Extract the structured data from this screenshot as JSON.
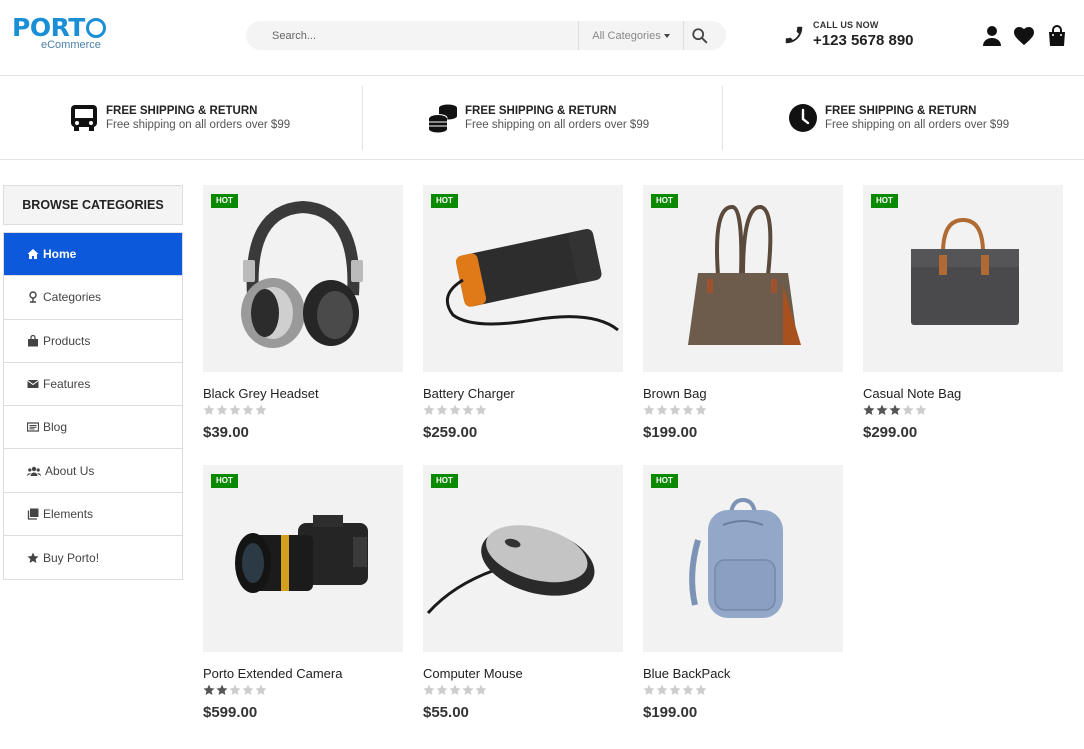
{
  "brand": {
    "name_prefix": "PORT",
    "sub": "eCommerce"
  },
  "search": {
    "placeholder": "Search...",
    "category": "All Categories"
  },
  "contact": {
    "label": "CALL US NOW",
    "number": "+123 5678 890"
  },
  "info_bar": [
    {
      "icon": "bus-icon",
      "title": "FREE SHIPPING & RETURN",
      "text": "Free shipping on all orders over $99"
    },
    {
      "icon": "coins-icon",
      "title": "FREE SHIPPING & RETURN",
      "text": "Free shipping on all orders over $99"
    },
    {
      "icon": "clock-icon",
      "title": "FREE SHIPPING & RETURN",
      "text": "Free shipping on all orders over $99"
    }
  ],
  "sidebar": {
    "title": "BROWSE CATEGORIES",
    "items": [
      {
        "label": "Home",
        "icon": "home-icon",
        "active": true
      },
      {
        "label": "Categories",
        "icon": "categories-icon"
      },
      {
        "label": "Products",
        "icon": "bag-icon"
      },
      {
        "label": "Features",
        "icon": "envelope-icon"
      },
      {
        "label": "Blog",
        "icon": "blog-icon"
      },
      {
        "label": "About Us",
        "icon": "users-icon"
      },
      {
        "label": "Elements",
        "icon": "layers-icon"
      },
      {
        "label": "Buy Porto!",
        "icon": "star-icon"
      }
    ]
  },
  "products": [
    {
      "badge": "HOT",
      "name": "Black Grey Headset",
      "rating": 0,
      "price": "$39.00",
      "image": "headset"
    },
    {
      "badge": "HOT",
      "name": "Battery Charger",
      "rating": 0,
      "price": "$259.00",
      "image": "battery"
    },
    {
      "badge": "HOT",
      "name": "Brown Bag",
      "rating": 0,
      "price": "$199.00",
      "image": "brown-bag"
    },
    {
      "badge": "HOT",
      "name": "Casual Note Bag",
      "rating": 3,
      "price": "$299.00",
      "image": "note-bag"
    },
    {
      "badge": "HOT",
      "name": "Porto Extended Camera",
      "rating": 2,
      "price": "$599.00",
      "image": "camera"
    },
    {
      "badge": "HOT",
      "name": "Computer Mouse",
      "rating": 0,
      "price": "$55.00",
      "image": "mouse"
    },
    {
      "badge": "HOT",
      "name": "Blue BackPack",
      "rating": 0,
      "price": "$199.00",
      "image": "backpack"
    }
  ],
  "colors": {
    "brand": "#1a8fd6",
    "active": "#0c5adb",
    "badge": "#0a8a00",
    "star_on": "#555555",
    "star_off": "#cccccc"
  }
}
